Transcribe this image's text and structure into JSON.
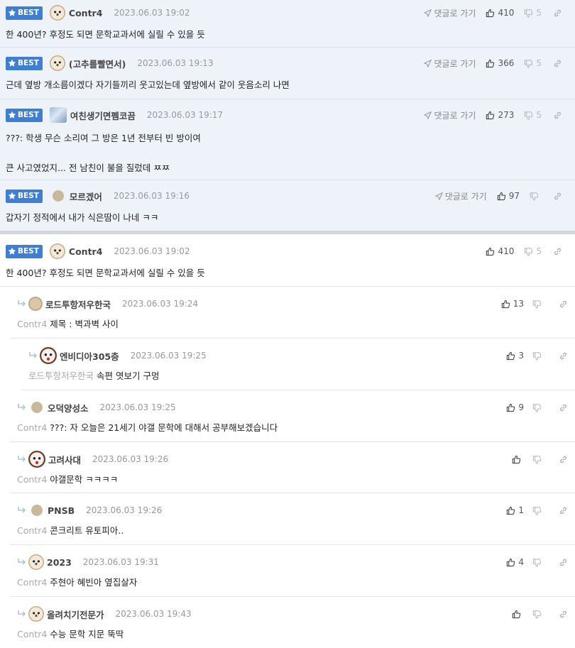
{
  "best_badge": "BEST",
  "goto_label": "댓글로 가기",
  "best_comments": [
    {
      "nick": "Contr4",
      "date": "2023.06.03 19:02",
      "text": "한 400년? 후정도 되면 문학교과서에 실릴 수 있을 듯",
      "up": "410",
      "down": "5"
    },
    {
      "nick": "(고추를빨면서)",
      "date": "2023.06.03 19:13",
      "text": "근데 옆방 개소름이겠다 자기들끼리 웃고있는데 옆방에서 같이 웃음소리 나면",
      "up": "366",
      "down": "5"
    },
    {
      "nick": "여친생기면펨코끔",
      "date": "2023.06.03 19:17",
      "text": "???: 학생 무슨 소리여 그 방은 1년 전부터 빈 방이여\n\n큰 사고였었지... 전 남친이 불을 질렀데 ㅉㅉ",
      "up": "273",
      "down": "5"
    },
    {
      "nick": "모르겠어",
      "date": "2023.06.03 19:16",
      "text": "갑자기 정적에서 내가 식은땀이 나네 ㅋㅋ",
      "up": "97",
      "down": ""
    }
  ],
  "main_comment": {
    "nick": "Contr4",
    "date": "2023.06.03 19:02",
    "text": "한 400년? 후정도 되면 문학교과서에 실릴 수 있을 듯",
    "up": "410",
    "down": "5"
  },
  "replies": [
    {
      "nick": "로드투항저우한국",
      "date": "2023.06.03 19:24",
      "target": "Contr4",
      "text": "제목 : 벽과벽 사이",
      "up": "13"
    },
    {
      "nick": "엔비디아305층",
      "date": "2023.06.03 19:25",
      "target": "로드투항저우한국",
      "text": "속편 엿보기 구멍",
      "up": "3"
    },
    {
      "nick": "오덕양성소",
      "date": "2023.06.03 19:25",
      "target": "Contr4",
      "text": "???: 자 오늘은 21세기 야갤 문학에 대해서 공부해보겠습니다",
      "up": "9"
    },
    {
      "nick": "고려사대",
      "date": "2023.06.03 19:26",
      "target": "Contr4",
      "text": "야갤문학 ㅋㅋㅋㅋ",
      "up": ""
    },
    {
      "nick": "PNSB",
      "date": "2023.06.03 19:26",
      "target": "Contr4",
      "text": "콘크리트 유토피아..",
      "up": "1"
    },
    {
      "nick": "2023",
      "date": "2023.06.03 19:31",
      "target": "Contr4",
      "text": "주현아 혜빈아 옆집살자",
      "up": "4"
    },
    {
      "nick": "올려치기전문가",
      "date": "2023.06.03 19:43",
      "target": "Contr4",
      "text": "수능 문학 지문 뚝딱",
      "up": ""
    }
  ]
}
